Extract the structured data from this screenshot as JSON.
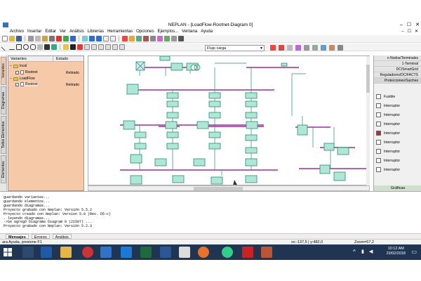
{
  "window": {
    "title": "NEPLAN - [LoadFlow-Rootnet-Diagram 0]",
    "minimize": "–",
    "maximize": "☐",
    "close": "✕"
  },
  "menu": [
    "Archivo",
    "Insertar",
    "Editar",
    "Ver",
    "Análisis",
    "Librerías",
    "Herramientas",
    "Opciones",
    "Ejemplos...",
    "Ventana",
    "Ayuda"
  ],
  "toolbar": {
    "view_combo": "Flujo carga"
  },
  "variants_panel": {
    "col_variants": "Variantes",
    "col_status": "Estado",
    "tree": [
      {
        "label": "local",
        "type": "folder",
        "level": 0
      },
      {
        "label": "Rootnet",
        "type": "variant",
        "level": 1,
        "status": "Retirado"
      },
      {
        "label": "LoadFlow",
        "type": "folder",
        "level": 0
      },
      {
        "label": "Rootnet",
        "type": "variant",
        "level": 1,
        "status": "Retirado"
      }
    ]
  },
  "side_tabs": [
    "Variantes",
    "Diagramas",
    "Todos Elementos",
    "Elementos"
  ],
  "right_panel": {
    "categories": [
      "n Nodos/Terminales",
      "1-Terminal",
      "DC/SmartGrid",
      "Reguladores/DC/FACTS",
      "Protecciones/Suiches"
    ],
    "items": [
      "Fusible",
      "Interruptor",
      "Interruptor",
      "Interruptor",
      "Interruptor",
      "Interruptor",
      "Interruptor",
      "Interruptor",
      "Interruptor"
    ],
    "footer": "Gráficas"
  },
  "messages": {
    "lines": [
      "guardando variantes...",
      "guardando elementos...",
      "guardando diagramas...",
      "Proyecto grabado con Neplan: Versión 5.5.2",
      "Proyecto creado con Neplan: Version 5.0 (Rev. D5-c)",
      ". leyendo diagramas...",
      "->Se agregó Diagrama Diagram 0 (21507) ...",
      "Proyecto grabado con Neplan: Versión 5.2.3"
    ],
    "tabs": [
      "Mensajes",
      "Errores",
      "Análisis"
    ]
  },
  "statusbar": {
    "help": "ara Ayuda, presione F1",
    "coords": "xx:-137,5 | y:482,0",
    "zoom": "Zoom=57,2"
  },
  "taskbar": {
    "time": "10:12 AM",
    "date": "23/02/2018"
  },
  "colors": {
    "bus": "#9b2f9b",
    "element_fill": "#aee7d6",
    "element_border": "#2b8b6b",
    "panel_peach": "#f6c9a9",
    "taskbar": "#1f3552"
  }
}
